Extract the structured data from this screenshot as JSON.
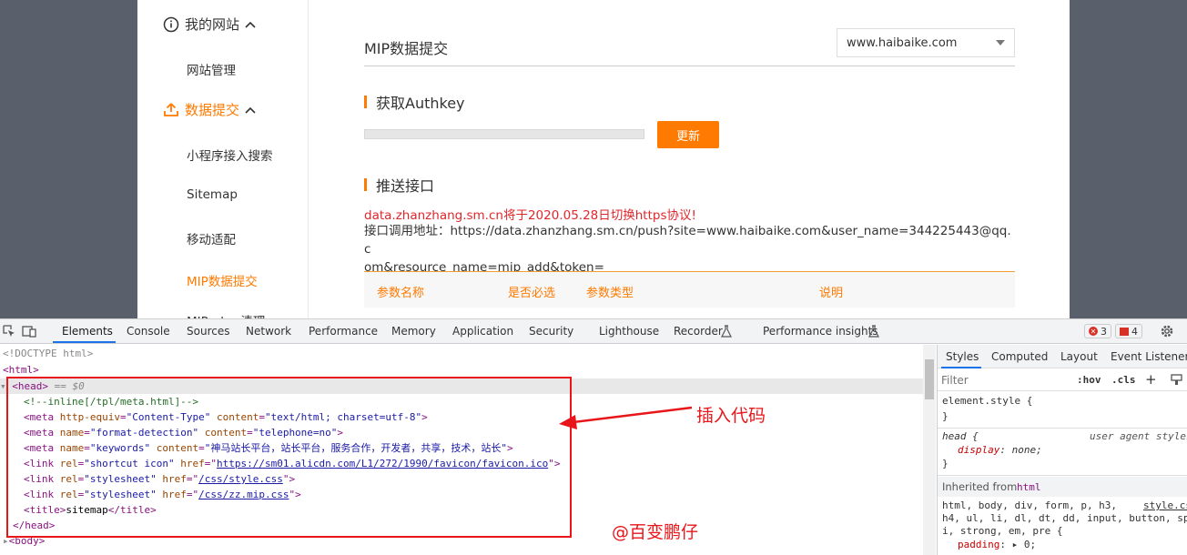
{
  "sidebar": {
    "group1": "我的网站",
    "item1": "网站管理",
    "group2": "数据提交",
    "items": [
      "小程序接入搜索",
      "Sitemap",
      "移动适配",
      "MIP数据提交",
      "MIP…h…清理"
    ]
  },
  "main": {
    "title": "MIP数据提交",
    "site_select": "www.haibaike.com",
    "section1": "获取Authkey",
    "update_button": "更新",
    "section2": "推送接口",
    "notice": "data.zhanzhang.sm.cn将于2020.05.28日切换https协议!",
    "api_line1": "接口调用地址：https://data.zhanzhang.sm.cn/push?site=www.haibaike.com&user_name=344225443@qq.c",
    "api_line2": "om&resource_name=mip_add&token=",
    "table_headers": [
      "参数名称",
      "是否必选",
      "参数类型",
      "说明"
    ]
  },
  "devtools": {
    "tabs": [
      "Elements",
      "Console",
      "Sources",
      "Network",
      "Performance",
      "Memory",
      "Application",
      "Security",
      "Lighthouse",
      "Recorder",
      "Performance insights"
    ],
    "errors": "3",
    "warnings": "4",
    "code": {
      "doctype": "<!DOCTYPE html>",
      "html": "<html>",
      "head_open": "<head>",
      "head_marker": " == $0",
      "comment": "<!--inline[/tpl/meta.html]-->",
      "meta1_tag": "<meta ",
      "meta1_a1": "http-equiv",
      "meta1_v1": "\"Content-Type\"",
      "meta1_a2": "content",
      "meta1_v2": "\"text/html; charset=utf-8\"",
      "meta2_a1": "name",
      "meta2_v1": "\"format-detection\"",
      "meta2_a2": "content",
      "meta2_v2": "\"telephone=no\"",
      "meta3_a1": "name",
      "meta3_v1": "\"keywords\"",
      "meta3_a2": "content",
      "meta3_v2": "\"神马站长平台，站长平台，服务合作，开发者，共享，技术，站长\"",
      "link1_a1": "rel",
      "link1_v1": "\"shortcut icon\"",
      "link1_a2": "href",
      "link1_url": "https://sm01.alicdn.com/L1/272/1990/favicon/favicon.ico",
      "link2_a1": "rel",
      "link2_v1": "\"stylesheet\"",
      "link2_a2": "href",
      "link2_url": "/css/style.css",
      "link3_a1": "rel",
      "link3_v1": "\"stylesheet\"",
      "link3_a2": "href",
      "link3_url": "/css/zz.mip.css",
      "title_text": "sitemap",
      "head_close": "</head>",
      "body_open": "<body>"
    },
    "annotation": "插入代码",
    "watermark": "@百变鹏仔"
  },
  "styles_panel": {
    "tabs": [
      "Styles",
      "Computed",
      "Layout",
      "Event Listeners"
    ],
    "filter_placeholder": "Filter",
    "hov": ":hov",
    "cls": ".cls",
    "element_style": "element.style {",
    "close_brace": "}",
    "head_rule": "head {",
    "user_agent": "user agent styles",
    "display_prop": "display",
    "display_val": "none;",
    "inherited_from": "Inherited from",
    "inherited_tag": "html",
    "selector_line1": "html, body, div, form, p, h3,",
    "source": "style.css",
    "selector_line2": "h4, ul, li, dl, dt, dd, input, button, sp",
    "selector_line3": "i, strong, em, pre {",
    "padding_prop": "padding",
    "padding_val": "0;"
  }
}
